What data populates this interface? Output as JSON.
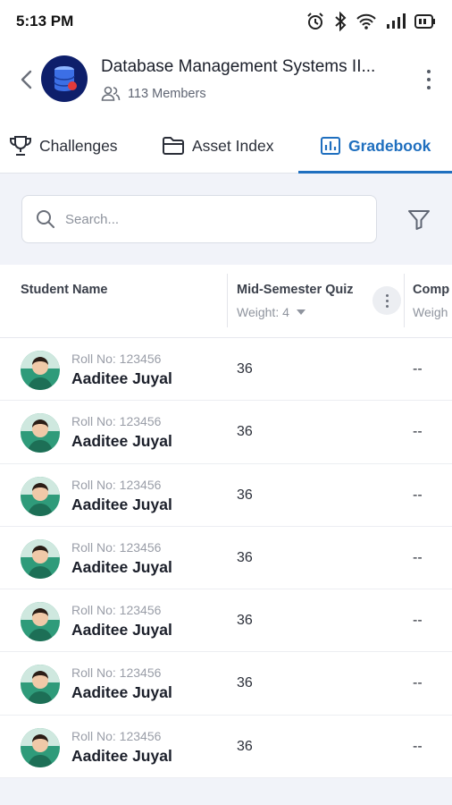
{
  "status_bar": {
    "time": "5:13 PM"
  },
  "header": {
    "title": "Database Management Systems II...",
    "members": "113 Members"
  },
  "tabs": [
    {
      "label": "Challenges",
      "icon": "trophy-icon"
    },
    {
      "label": "Asset Index",
      "icon": "folder-icon"
    },
    {
      "label": "Gradebook",
      "icon": "bar-chart-icon",
      "active": true
    }
  ],
  "search": {
    "placeholder": "Search..."
  },
  "table": {
    "columns": {
      "student": "Student Name",
      "quiz": {
        "label": "Mid-Semester Quiz",
        "weight": "Weight: 4"
      },
      "comp": {
        "label": "Comp",
        "weight": "Weigh"
      }
    },
    "rows": [
      {
        "roll": "Roll No: 123456",
        "name": "Aaditee Juyal",
        "score": "36",
        "comp": "--"
      },
      {
        "roll": "Roll No: 123456",
        "name": "Aaditee Juyal",
        "score": "36",
        "comp": "--"
      },
      {
        "roll": "Roll No: 123456",
        "name": "Aaditee Juyal",
        "score": "36",
        "comp": "--"
      },
      {
        "roll": "Roll No: 123456",
        "name": "Aaditee Juyal",
        "score": "36",
        "comp": "--"
      },
      {
        "roll": "Roll No: 123456",
        "name": "Aaditee Juyal",
        "score": "36",
        "comp": "--"
      },
      {
        "roll": "Roll No: 123456",
        "name": "Aaditee Juyal",
        "score": "36",
        "comp": "--"
      },
      {
        "roll": "Roll No: 123456",
        "name": "Aaditee Juyal",
        "score": "36",
        "comp": "--"
      }
    ]
  },
  "colors": {
    "accent": "#1f6fbf",
    "avatar_bg": "#0e1f6b",
    "row_avatar_bg": "#2f9b7a"
  }
}
